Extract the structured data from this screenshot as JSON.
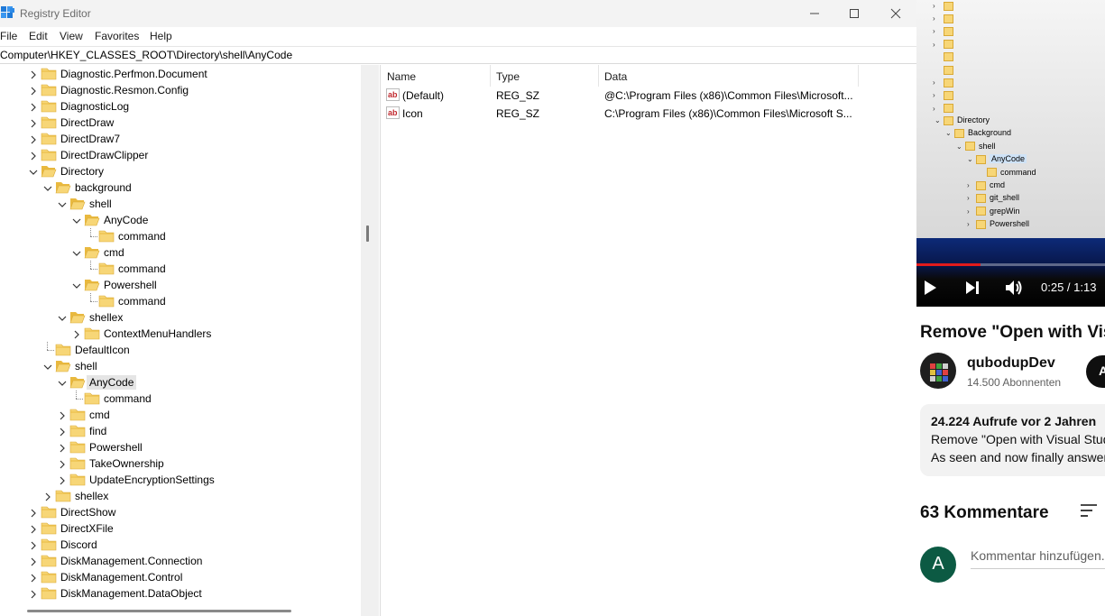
{
  "window": {
    "title": "Registry Editor",
    "minimize_glyph": "—",
    "maximize_glyph": "☐",
    "close_glyph": "✕"
  },
  "menu": [
    "File",
    "Edit",
    "View",
    "Favorites",
    "Help"
  ],
  "address": "Computer\\HKEY_CLASSES_ROOT\\Directory\\shell\\AnyCode",
  "tree": [
    {
      "label": "Diagnostic.Perfmon.Document",
      "level": 0,
      "state": "collapsed"
    },
    {
      "label": "Diagnostic.Resmon.Config",
      "level": 0,
      "state": "collapsed"
    },
    {
      "label": "DiagnosticLog",
      "level": 0,
      "state": "collapsed"
    },
    {
      "label": "DirectDraw",
      "level": 0,
      "state": "collapsed"
    },
    {
      "label": "DirectDraw7",
      "level": 0,
      "state": "collapsed"
    },
    {
      "label": "DirectDrawClipper",
      "level": 0,
      "state": "collapsed"
    },
    {
      "label": "Directory",
      "level": 0,
      "state": "expanded"
    },
    {
      "label": "background",
      "level": 1,
      "state": "expanded"
    },
    {
      "label": "shell",
      "level": 2,
      "state": "expanded"
    },
    {
      "label": "AnyCode",
      "level": 3,
      "state": "expanded"
    },
    {
      "label": "command",
      "level": 4,
      "state": "leaf"
    },
    {
      "label": "cmd",
      "level": 3,
      "state": "expanded"
    },
    {
      "label": "command",
      "level": 4,
      "state": "leaf"
    },
    {
      "label": "Powershell",
      "level": 3,
      "state": "expanded"
    },
    {
      "label": "command",
      "level": 4,
      "state": "leaf"
    },
    {
      "label": "shellex",
      "level": 2,
      "state": "expanded"
    },
    {
      "label": "ContextMenuHandlers",
      "level": 3,
      "state": "collapsed"
    },
    {
      "label": "DefaultIcon",
      "level": 1,
      "state": "leaf"
    },
    {
      "label": "shell",
      "level": 1,
      "state": "expanded"
    },
    {
      "label": "AnyCode",
      "level": 2,
      "state": "expanded",
      "selected": true
    },
    {
      "label": "command",
      "level": 3,
      "state": "leaf"
    },
    {
      "label": "cmd",
      "level": 2,
      "state": "collapsed"
    },
    {
      "label": "find",
      "level": 2,
      "state": "collapsed"
    },
    {
      "label": "Powershell",
      "level": 2,
      "state": "collapsed"
    },
    {
      "label": "TakeOwnership",
      "level": 2,
      "state": "collapsed"
    },
    {
      "label": "UpdateEncryptionSettings",
      "level": 2,
      "state": "collapsed"
    },
    {
      "label": "shellex",
      "level": 1,
      "state": "collapsed"
    },
    {
      "label": "DirectShow",
      "level": 0,
      "state": "collapsed"
    },
    {
      "label": "DirectXFile",
      "level": 0,
      "state": "collapsed"
    },
    {
      "label": "Discord",
      "level": 0,
      "state": "collapsed"
    },
    {
      "label": "DiskManagement.Connection",
      "level": 0,
      "state": "collapsed"
    },
    {
      "label": "DiskManagement.Control",
      "level": 0,
      "state": "collapsed"
    },
    {
      "label": "DiskManagement.DataObject",
      "level": 0,
      "state": "collapsed"
    }
  ],
  "columns": [
    "Name",
    "Type",
    "Data"
  ],
  "values": [
    {
      "name": "(Default)",
      "type": "REG_SZ",
      "data": "@C:\\Program Files (x86)\\Common Files\\Microsoft..."
    },
    {
      "name": "Icon",
      "type": "REG_SZ",
      "data": "C:\\Program Files (x86)\\Common Files\\Microsoft S..."
    }
  ],
  "video": {
    "tree": [
      {
        "label": "Directory",
        "level": 0,
        "chev": "v"
      },
      {
        "label": "Background",
        "level": 1,
        "chev": "v"
      },
      {
        "label": "shell",
        "level": 2,
        "chev": "v"
      },
      {
        "label": "AnyCode",
        "level": 3,
        "chev": "v",
        "selected": true
      },
      {
        "label": "command",
        "level": 4,
        "chev": ""
      },
      {
        "label": "cmd",
        "level": 3,
        "chev": ">"
      },
      {
        "label": "git_shell",
        "level": 3,
        "chev": ">"
      },
      {
        "label": "grepWin",
        "level": 3,
        "chev": ">"
      },
      {
        "label": "Powershell",
        "level": 3,
        "chev": ">"
      }
    ],
    "time": "0:25 / 1:13",
    "progress": 0.34
  },
  "youtube": {
    "title": "Remove \"Open with Visual Studio\"",
    "channel": "qubodupDev",
    "subscribers": "14.500 Abonnenten",
    "subscribe_initial": "A",
    "views_line": "24.224 Aufrufe  vor 2 Jahren",
    "desc_line1": "Remove \"Open with Visual Studio\"",
    "desc_line2": "As seen and now finally answered",
    "comments_count": "63 Kommentare",
    "user_initial": "A",
    "comment_placeholder": "Kommentar hinzufügen..."
  },
  "colors": {
    "folder_fill": "#f7d677",
    "folder_edge": "#d9a935",
    "selection": "#e5e5e5",
    "progress": "#e21b1b",
    "user_avatar": "#0c5a43"
  }
}
